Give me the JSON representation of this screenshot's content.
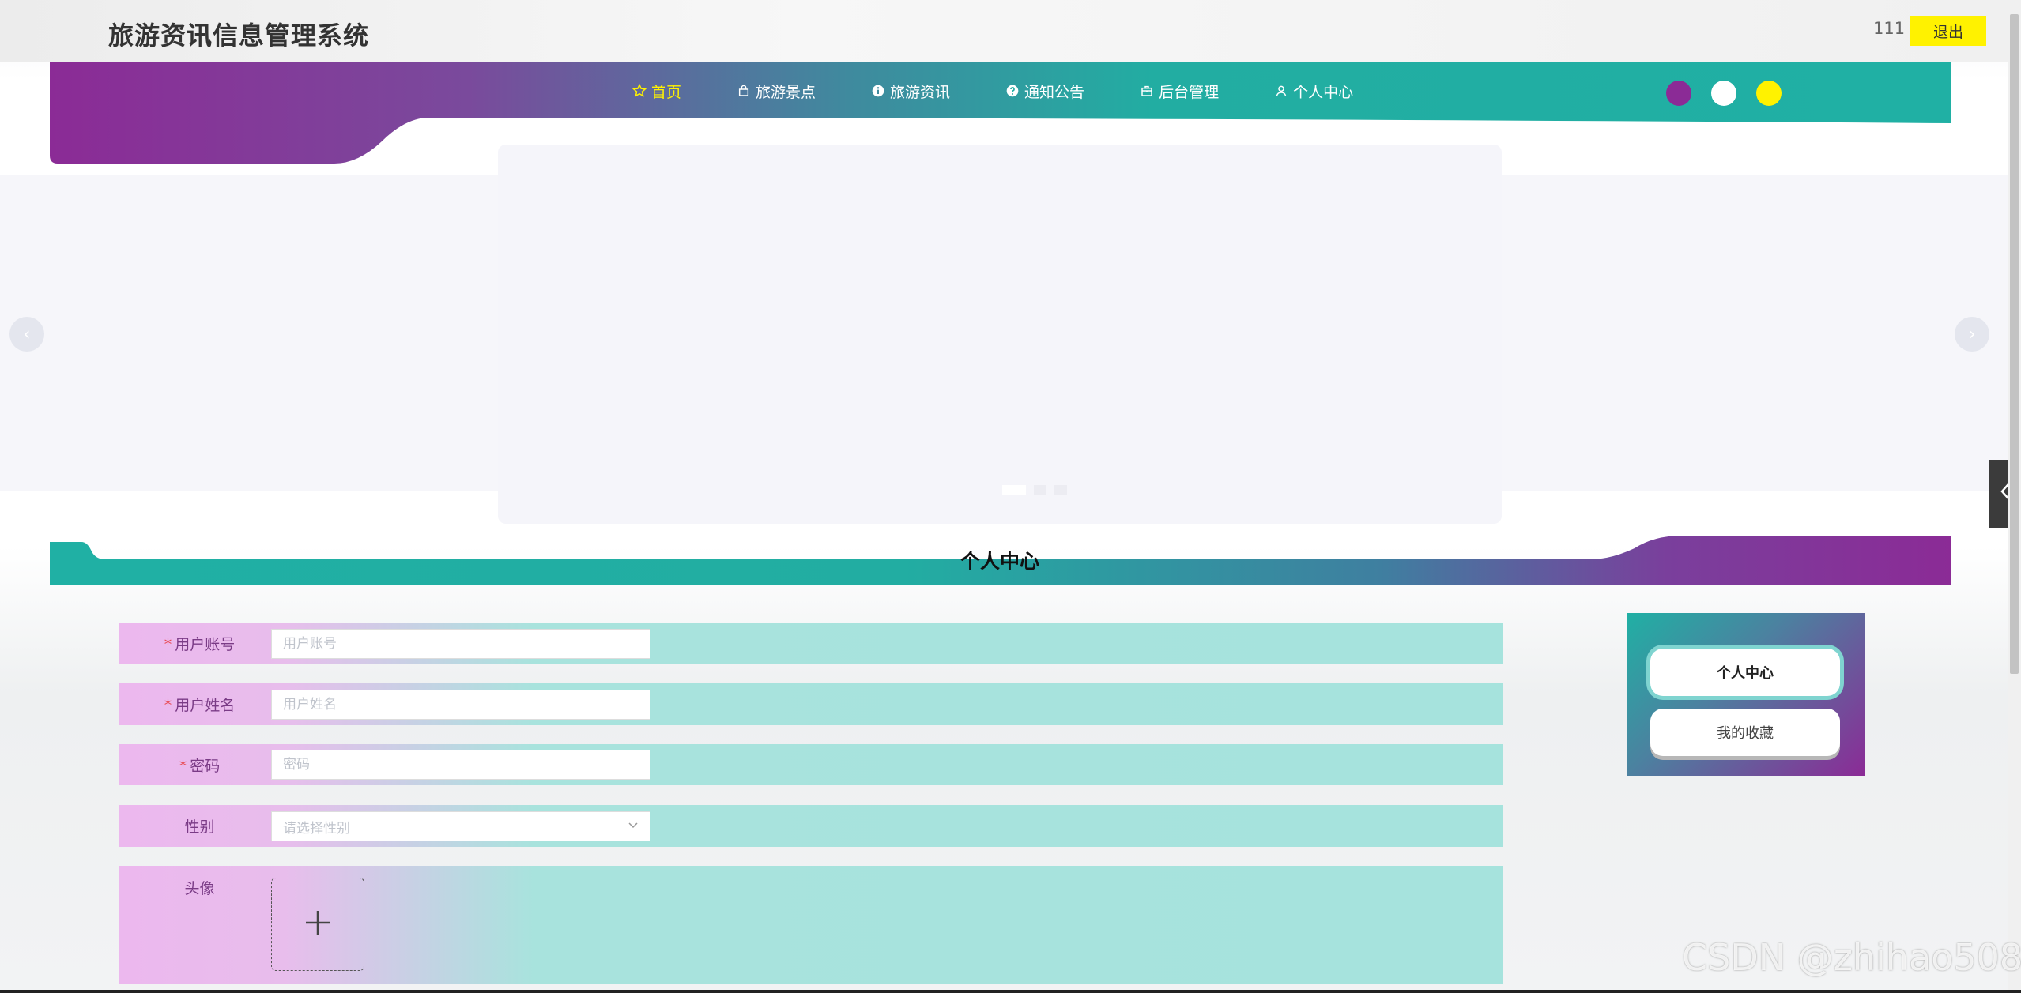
{
  "app": {
    "title": "旅游资讯信息管理系统"
  },
  "user": {
    "name": "111",
    "logout_label": "退出"
  },
  "nav": {
    "items": [
      {
        "label": "首页",
        "icon": "star-icon",
        "active": true
      },
      {
        "label": "旅游景点",
        "icon": "bag-icon",
        "active": false
      },
      {
        "label": "旅游资讯",
        "icon": "info-icon",
        "active": false
      },
      {
        "label": "通知公告",
        "icon": "help-icon",
        "active": false
      },
      {
        "label": "后台管理",
        "icon": "box-icon",
        "active": false
      },
      {
        "label": "个人中心",
        "icon": "user-icon",
        "active": false
      }
    ]
  },
  "theme_colors": [
    "#8b2b96",
    "#ffffff",
    "#fff200"
  ],
  "colors": {
    "accent_teal": "#20b0a4",
    "accent_purple": "#8b2b96",
    "logout_yellow": "#fff200"
  },
  "carousel": {
    "prev": "‹",
    "next": "›",
    "slides": 3,
    "active_slide": 0
  },
  "section": {
    "title": "个人中心"
  },
  "form": {
    "fields": [
      {
        "label": "用户账号",
        "required": true,
        "placeholder": "用户账号",
        "type": "text"
      },
      {
        "label": "用户姓名",
        "required": true,
        "placeholder": "用户姓名",
        "type": "text"
      },
      {
        "label": "密码",
        "required": true,
        "placeholder": "密码",
        "type": "password"
      },
      {
        "label": "性别",
        "required": false,
        "placeholder": "请选择性别",
        "type": "select"
      },
      {
        "label": "头像",
        "required": false,
        "placeholder": "",
        "type": "upload"
      }
    ]
  },
  "side_menu": {
    "items": [
      {
        "label": "个人中心",
        "active": true
      },
      {
        "label": "我的收藏",
        "active": false
      }
    ]
  },
  "watermark": "CSDN @zhihao508"
}
